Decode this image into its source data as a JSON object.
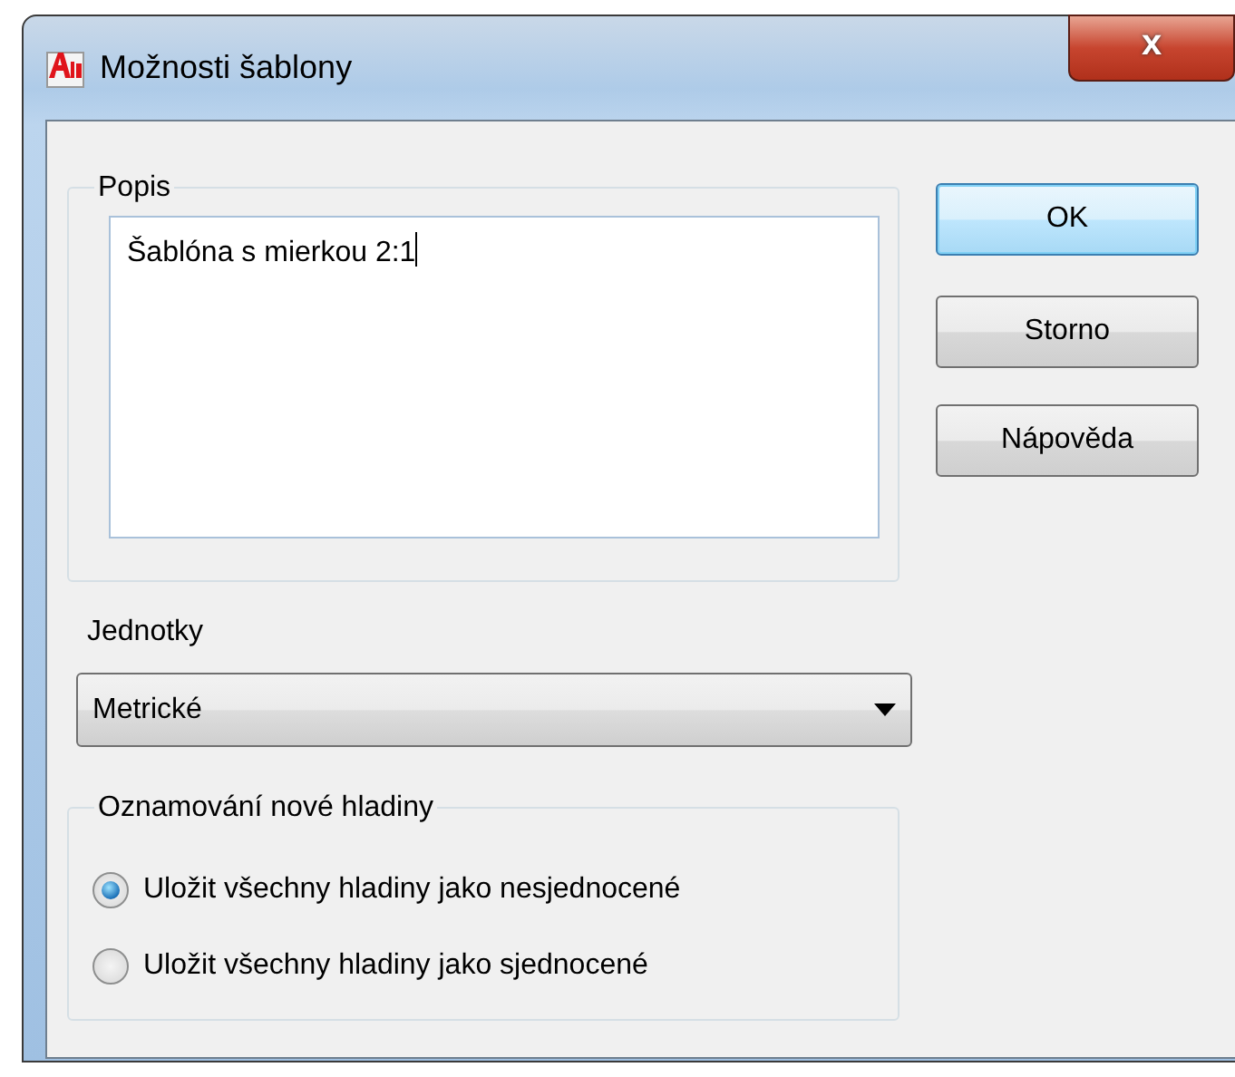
{
  "window": {
    "title": "Možnosti šablony",
    "close_label": "x"
  },
  "description": {
    "legend": "Popis",
    "value": "Šablóna s mierkou 2:1"
  },
  "buttons": [
    {
      "label": "OK",
      "default": true
    },
    {
      "label": "Storno",
      "default": false
    },
    {
      "label": "Nápověda",
      "default": false
    }
  ],
  "units": {
    "label": "Jednotky",
    "value": "Metrické"
  },
  "layer_notification": {
    "legend": "Oznamování nové hladiny",
    "options": [
      {
        "label": "Uložit všechny hladiny jako nesjednocené",
        "selected": true
      },
      {
        "label": "Uložit všechny hladiny jako sjednocené",
        "selected": false
      }
    ]
  }
}
